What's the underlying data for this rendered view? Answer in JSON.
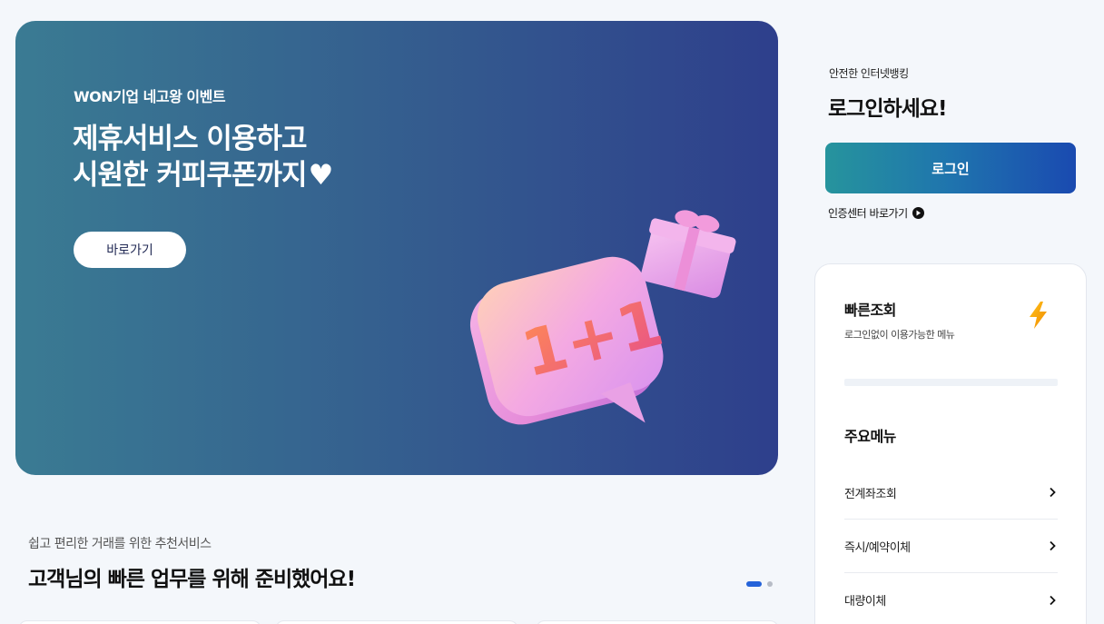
{
  "banner": {
    "eyebrow": "WON기업 네고왕 이벤트",
    "title_line1": "제휴서비스 이용하고",
    "title_line2": "시원한 커피쿠폰까지",
    "heart": "♥",
    "cta_label": "바로가기",
    "illustration_text": "1+1",
    "gradient_colors": [
      "#3a7b93",
      "#2e3f8c"
    ]
  },
  "recommend": {
    "subtitle": "쉽고 편리한 거래를 위한 추천서비스",
    "title": "고객님의 빠른 업무를 위해 준비했어요!",
    "pager": {
      "active_index": 1,
      "total": 2,
      "active_color": "#2563d9"
    }
  },
  "login": {
    "eyebrow": "안전한 인터넷뱅킹",
    "title": "로그인하세요!",
    "button_label": "로그인",
    "cert_link_label": "인증센터 바로가기",
    "cert_link_icon": "play-circle-icon"
  },
  "quick": {
    "title": "빠른조회",
    "subtitle": "로그인없이 이용가능한 메뉴",
    "icon": "lightning-icon",
    "main_menu_title": "주요메뉴",
    "menu_items": [
      {
        "label": "전계좌조회"
      },
      {
        "label": "즉시/예약이체"
      },
      {
        "label": "대량이체"
      }
    ]
  }
}
